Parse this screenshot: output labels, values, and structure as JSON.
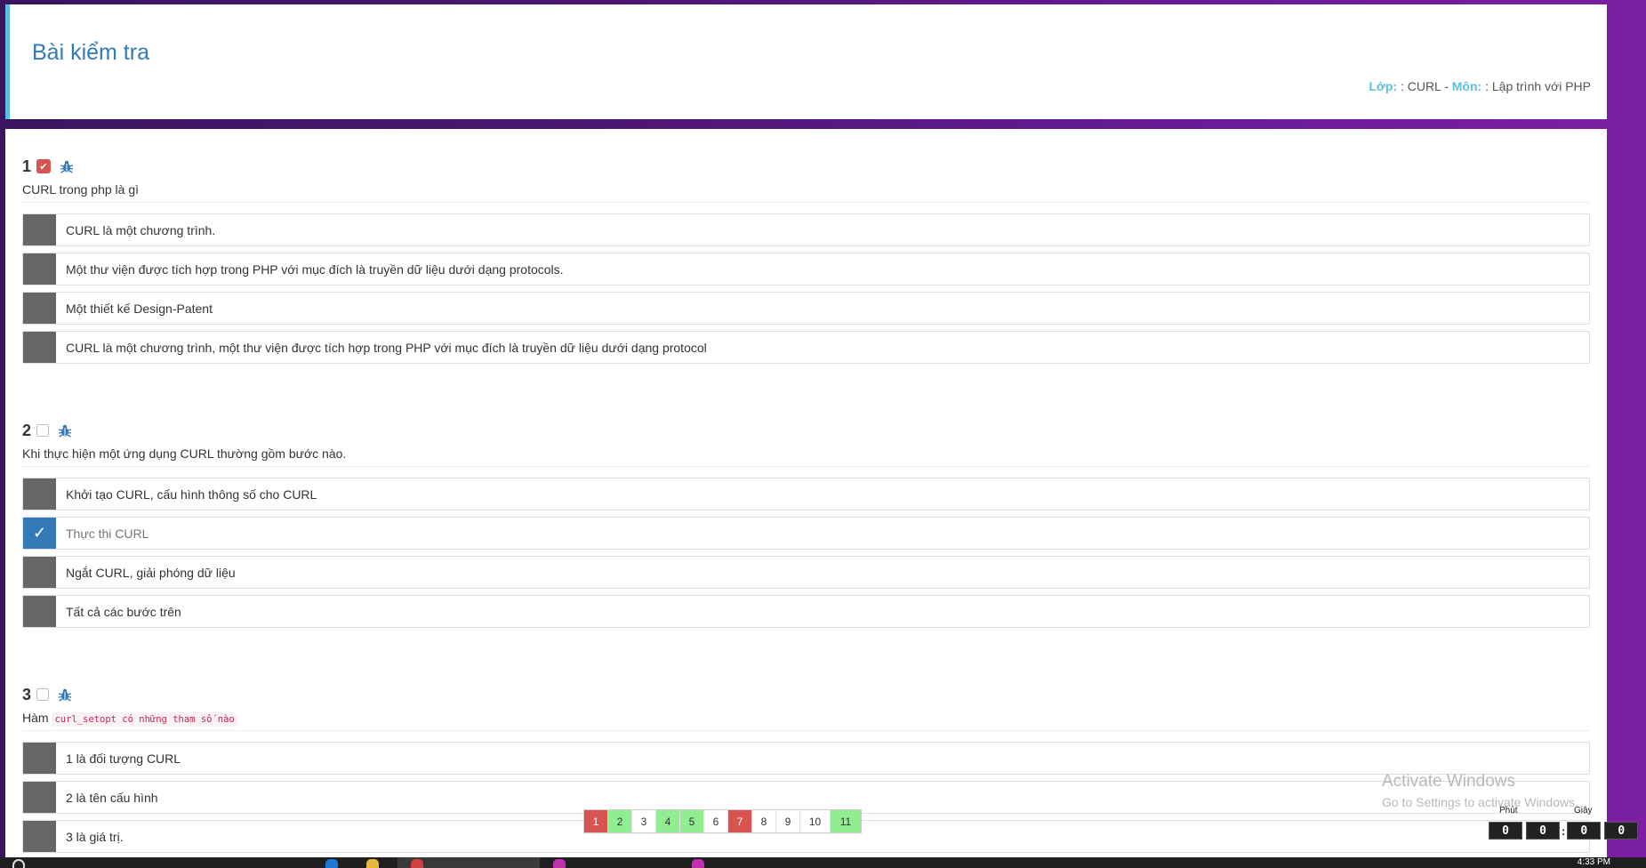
{
  "header": {
    "title": "Bài kiểm tra",
    "class_label": "Lớp:",
    "class_value": ": CURL -",
    "subject_label": "Môn:",
    "subject_value": ": Lập trình với PHP"
  },
  "questions": [
    {
      "number": "1",
      "flagged": true,
      "text": "CURL trong php là gì",
      "answers": [
        {
          "label": "CURL là một chương trình.",
          "selected": false
        },
        {
          "label": "Một thư viện được tích hợp trong PHP với mục đích là truyền dữ liệu dưới dạng protocols.",
          "selected": false
        },
        {
          "label": "Một thiết kế Design-Patent",
          "selected": false
        },
        {
          "label": "CURL là một chương trình, một thư viện được tích hợp trong PHP với mục đích là truyền dữ liệu dưới dạng protocol",
          "selected": false
        }
      ]
    },
    {
      "number": "2",
      "flagged": false,
      "text": "Khi thực hiện một ứng dụng CURL thường gồm bước nào.",
      "answers": [
        {
          "label": "Khởi tạo CURL, cấu hình thông số cho CURL",
          "selected": false
        },
        {
          "label": "Thực thi CURL",
          "selected": true
        },
        {
          "label": "Ngắt CURL, giải phóng dữ liệu",
          "selected": false
        },
        {
          "label": "Tất cả các bước trên",
          "selected": false
        }
      ]
    },
    {
      "number": "3",
      "flagged": false,
      "text_prefix": "Hàm",
      "text_code": "curl_setopt có những tham số nào",
      "answers": [
        {
          "label": "1 là đối tượng CURL",
          "selected": false
        },
        {
          "label": "2 là tên cấu hình",
          "selected": false
        },
        {
          "label": "3 là giá trị.",
          "selected": false
        }
      ]
    }
  ],
  "pagination": [
    {
      "label": "1",
      "status": "red"
    },
    {
      "label": "2",
      "status": "green"
    },
    {
      "label": "3",
      "status": "none"
    },
    {
      "label": "4",
      "status": "green"
    },
    {
      "label": "5",
      "status": "green"
    },
    {
      "label": "6",
      "status": "none"
    },
    {
      "label": "7",
      "status": "red"
    },
    {
      "label": "8",
      "status": "none"
    },
    {
      "label": "9",
      "status": "none"
    },
    {
      "label": "10",
      "status": "none"
    },
    {
      "label": "11",
      "status": "green"
    }
  ],
  "timer": {
    "minutes_label": "Phút",
    "seconds_label": "Giây",
    "digits": [
      "0",
      "0",
      "0",
      "0"
    ],
    "separator": ":"
  },
  "watermark": {
    "line1": "Activate Windows",
    "line2": "Go to Settings to activate Windows."
  },
  "taskbar": {
    "clock": "4:33 PM"
  },
  "colors": {
    "accent": "#337ab7",
    "info": "#5bc0de",
    "danger": "#d9534f",
    "success": "#90ee90",
    "answer_box": "#666666"
  }
}
